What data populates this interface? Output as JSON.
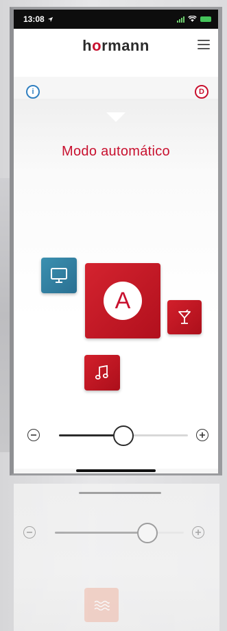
{
  "status_bar": {
    "time": "13:08"
  },
  "header": {
    "logo_text_pre": "h",
    "logo_dot": "o",
    "logo_text_post": "rmann"
  },
  "info_left": "i",
  "info_right": "D",
  "mode": {
    "title": "Modo automático",
    "active_tile_letter": "A"
  },
  "slider": {
    "minus": "⊖",
    "plus": "⊕",
    "value_fraction": 0.5
  },
  "reflection_slider": {
    "value_fraction": 0.72
  },
  "icons": {
    "tv": "monitor-icon",
    "party": "cocktail-icon",
    "music": "music-note-icon",
    "reflection": "waves-icon"
  },
  "colors": {
    "accent": "#c8102e",
    "tv_tile": "#3b90b0",
    "reflection_tile": "#f1c4b6"
  }
}
